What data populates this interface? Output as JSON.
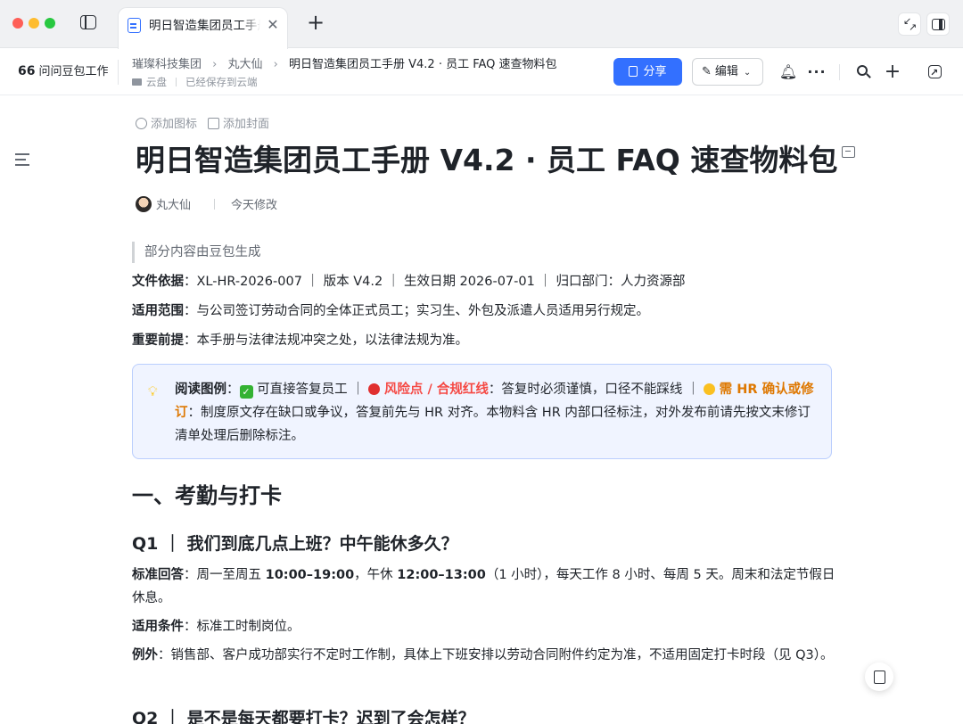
{
  "window": {
    "tab_title": "明日智造集团员工手册",
    "tab_close": "✕",
    "new_tab": "+"
  },
  "header": {
    "ask_label": "问问豆包工作",
    "ask_quote": "66",
    "breadcrumbs": [
      "璀璨科技集团",
      "丸大仙",
      "明日智造集团员工手册 V4.2 · 员工 FAQ 速查物料包"
    ],
    "breadcrumb_sep": "›",
    "location": "云盘",
    "save_status": "已经保存到云端",
    "share_label": "分享",
    "edit_label": "编辑",
    "edit_icon": "✎",
    "chevron": "⌄",
    "bell": "🔔︎",
    "more": "···",
    "plus": "+",
    "open_arrow": "↗"
  },
  "doc": {
    "add_icon_label": "添加图标",
    "add_cover_label": "添加封面",
    "title": "明日智造集团员工手册 V4.2 · 员工 FAQ 速查物料包",
    "author": "丸大仙",
    "modified": "今天修改",
    "ai_note": "部分内容由豆包生成",
    "basis_label": "文件依据",
    "basis_text": "：XL-HR-2026-007 ｜ 版本 V4.2 ｜ 生效日期 2026-07-01 ｜ 归口部门：人力资源部",
    "scope_label": "适用范围",
    "scope_text": "：与公司签订劳动合同的全体正式员工；实习生、外包及派遣人员适用另行规定。",
    "premise_label": "重要前提",
    "premise_text": "：本手册与法律法规冲突之处，以法律法规为准。",
    "callout": {
      "bulb": "💡︎",
      "legend_label": "阅读图例",
      "colon": "：",
      "check": "✓",
      "ok_text": "可直接答复员工 ｜ ",
      "risk_label": "风险点 / 合规红线",
      "risk_text": "：答复时必须谨慎，口径不能踩线 ｜ ",
      "hr_label": "需 HR 确认或修订",
      "hr_text": "：制度原文存在缺口或争议，答复前先与 HR 对齐。本物料含 HR 内部口径标注，对外发布前请先按文末修订清单处理后删除标注。"
    },
    "section1": "一、考勤与打卡",
    "q1": "Q1 ｜ 我们到底几点上班？中午能休多久？",
    "a1_label": "标准回答",
    "a1_pre": "：周一至周五 ",
    "a1_work": "10:00–19:00",
    "a1_mid": "，午休 ",
    "a1_lunch": "12:00–13:00",
    "a1_post": "（1 小时），每天工作 8 小时、每周 5 天。周末和法定节假日休息。",
    "cond_label": "适用条件",
    "cond_text": "：标准工时制岗位。",
    "exc_label": "例外",
    "exc_text": "：销售部、客户成功部实行不定时工作制，具体上下班安排以劳动合同附件约定为准，不适用固定打卡时段（见 Q3）。",
    "q2": "Q2 ｜ 是不是每天都要打卡？迟到了会怎样？"
  },
  "colors": {
    "accent": "#3370ff",
    "risk": "#f54a45",
    "hr_confirm": "#de7802",
    "callout_bg": "#f0f4ff"
  }
}
